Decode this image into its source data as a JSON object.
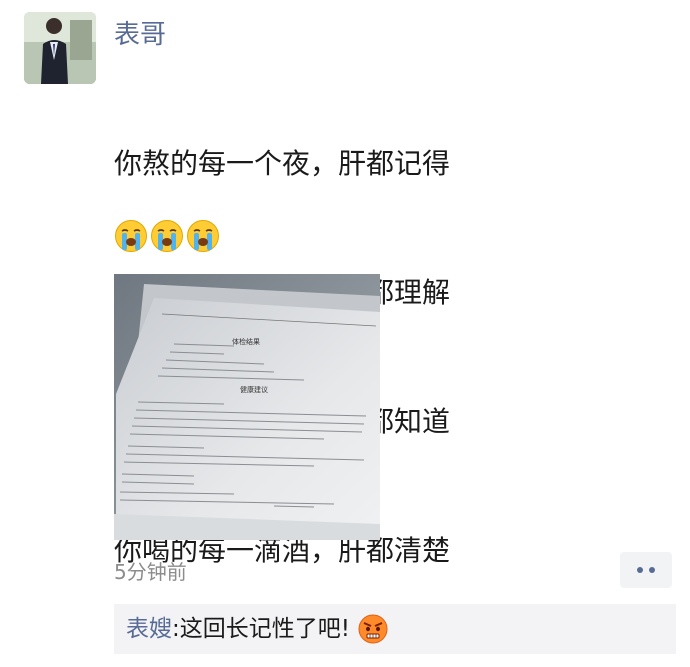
{
  "post": {
    "author": "表哥",
    "lines": [
      "你熬的每一个夜，肝都记得",
      "你生的每一次气，肝都理解",
      "你吃的每一口饭，肝都知道",
      "你喝的每一滴酒，肝都清楚"
    ],
    "emojis": [
      "crying-face-icon",
      "crying-face-icon",
      "crying-face-icon"
    ],
    "photo": {
      "doc_titles": [
        "体检结果",
        "健康建议"
      ]
    },
    "timestamp": "5分钟前"
  },
  "comments": [
    {
      "author": "表嫂",
      "separator": ": ",
      "text": "这回长记性了吧!",
      "emoji": "angry-face-icon"
    }
  ]
}
